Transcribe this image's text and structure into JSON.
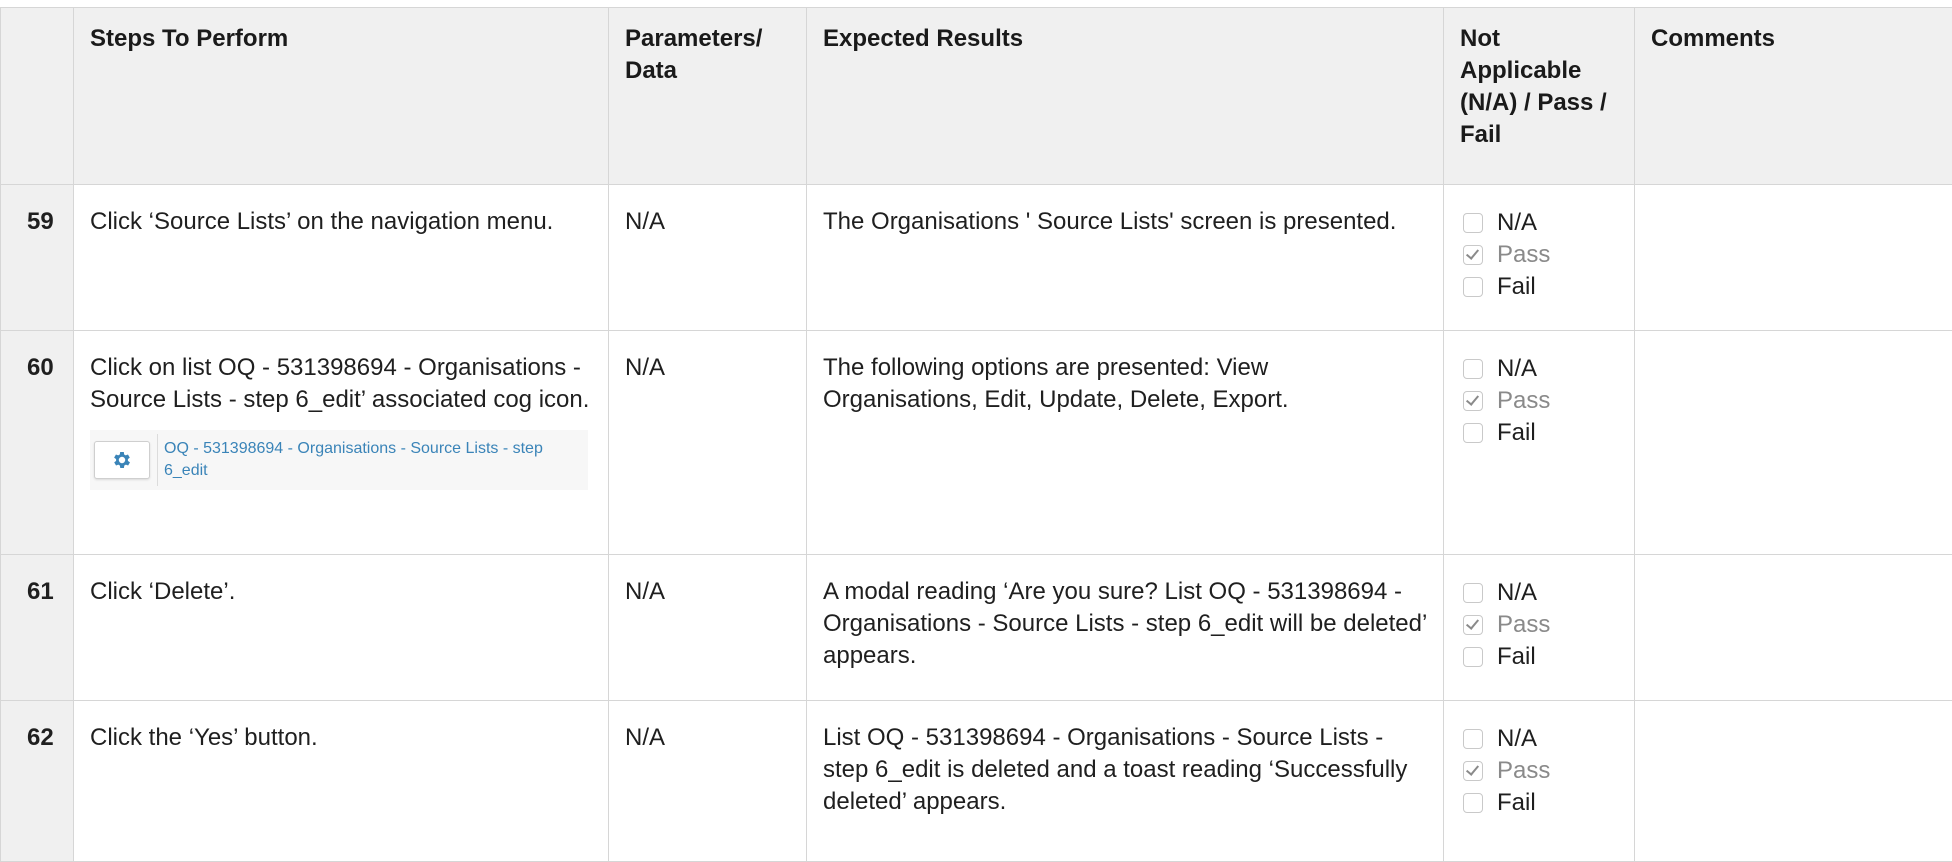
{
  "table": {
    "headers": {
      "steps": "Steps To Perform",
      "params": "Parameters/ Data",
      "expected": "Expected Results",
      "status": "Not Applicable (N/A) / Pass / Fail",
      "comments": "Comments"
    },
    "status_options": [
      "N/A",
      "Pass",
      "Fail"
    ],
    "rows": [
      {
        "num": "59",
        "step": "Click ‘Source Lists’ on the navigation menu.",
        "params": "N/A",
        "expected": "The Organisations ' Source Lists' screen is presented.",
        "checked": "Pass",
        "comments": ""
      },
      {
        "num": "60",
        "step": "Click on list OQ - 531398694 - Organisations - Source Lists - step 6_edit’ associated cog icon.",
        "params": "N/A",
        "expected": "The following options are presented: View Organisations, Edit, Update, Delete, Export.",
        "checked": "Pass",
        "comments": "",
        "screenshot": {
          "icon": "cog-icon",
          "link": "OQ - 531398694 - Organisations - Source Lists - step 6_edit"
        }
      },
      {
        "num": "61",
        "step": "Click ‘Delete’.",
        "params": "N/A",
        "expected": "A modal reading ‘Are you sure? List OQ - 531398694 - Organisations - Source Lists - step 6_edit will be deleted’ appears.",
        "checked": "Pass",
        "comments": ""
      },
      {
        "num": "62",
        "step": "Click the ‘Yes’ button.",
        "params": "N/A",
        "expected": "List OQ - 531398694 - Organisations - Source Lists - step 6_edit is deleted and a toast reading ‘Successfully deleted’ appears.",
        "checked": "Pass",
        "comments": ""
      }
    ]
  },
  "colors": {
    "header_bg": "#f0f0f0",
    "border": "#d6d6d6",
    "link": "#3a84b8",
    "muted": "#8a8a8a"
  }
}
